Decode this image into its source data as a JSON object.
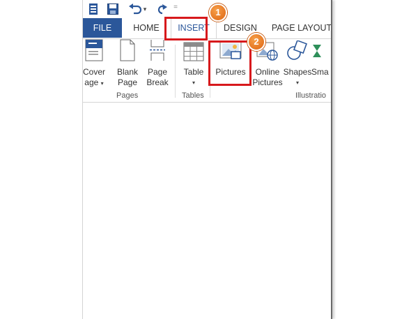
{
  "tabs": {
    "file": "FILE",
    "home": "HOME",
    "insert": "INSERT",
    "design": "DESIGN",
    "page_layout": "PAGE LAYOUT"
  },
  "ribbon": {
    "cover_page": {
      "line1": "Cover",
      "line2": "age"
    },
    "blank_page": {
      "line1": "Blank",
      "line2": "Page"
    },
    "page_break": {
      "line1": "Page",
      "line2": "Break"
    },
    "table": {
      "line1": "Table"
    },
    "pictures": {
      "line1": "Pictures"
    },
    "online_pictures": {
      "line1": "Online",
      "line2": "Pictures"
    },
    "shapes": {
      "line1": "Shapes"
    },
    "smartart": {
      "line1": "Sma"
    },
    "groups": {
      "pages": "Pages",
      "tables": "Tables",
      "illustrations": "Illustratio"
    }
  },
  "callouts": {
    "step1": "1",
    "step2": "2"
  },
  "colors": {
    "file_tab": "#2b579a",
    "active_tab_text": "#2b579a",
    "callout_red": "#d7191c",
    "badge_orange": "#e8741e"
  },
  "icons": [
    "word-icon",
    "save-icon",
    "undo-icon",
    "redo-icon",
    "cover-page-icon",
    "blank-page-icon",
    "page-break-icon",
    "table-icon",
    "pictures-icon",
    "online-pictures-icon",
    "shapes-icon",
    "smartart-icon"
  ]
}
